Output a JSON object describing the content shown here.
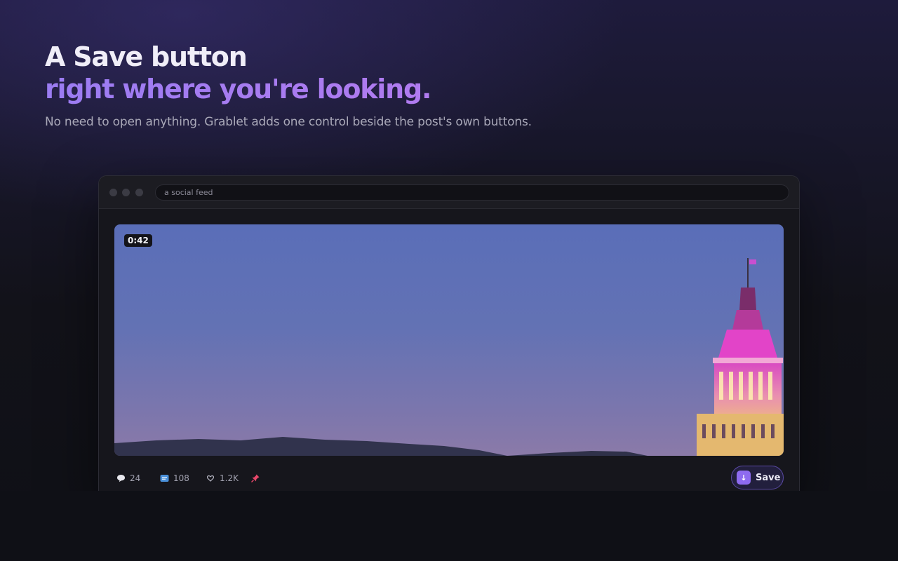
{
  "hero": {
    "title_line1": "A Save button",
    "title_line2": "right where you're looking.",
    "subtitle": "No need to open anything. Grablet adds one control beside the post's own buttons."
  },
  "browser": {
    "address_text": "a social feed"
  },
  "post": {
    "duration": "0:42",
    "image_alt": "skyscraper-at-dusk",
    "stats": {
      "comments": "24",
      "shares": "108",
      "likes": "1.2K"
    },
    "save_label": "Save",
    "save_icon_glyph": "↓"
  },
  "colors": {
    "accent": "#8e6bf0",
    "title_gradient_start": "#9b7cf2",
    "background": "#0f1016"
  },
  "icons": {
    "comments": "speech-bubble-icon",
    "shares": "chat-card-icon",
    "likes": "heart-icon",
    "pin": "pushpin-icon",
    "save": "download-arrow-icon"
  }
}
